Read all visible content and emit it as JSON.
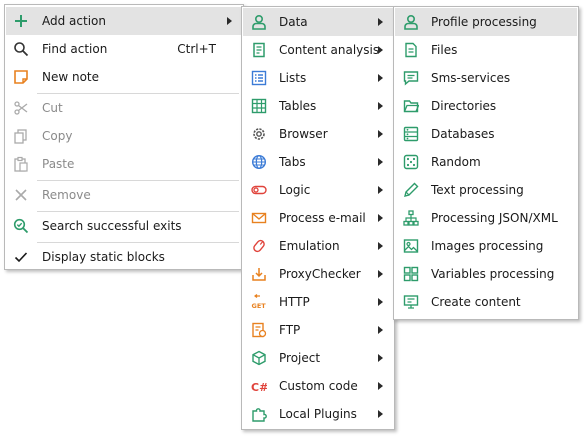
{
  "context_menu": {
    "items": [
      {
        "label": "Add action",
        "shortcut": ""
      },
      {
        "label": "Find action",
        "shortcut": "Ctrl+T"
      },
      {
        "label": "New note",
        "shortcut": ""
      },
      {
        "label": "Cut",
        "shortcut": ""
      },
      {
        "label": "Copy",
        "shortcut": ""
      },
      {
        "label": "Paste",
        "shortcut": ""
      },
      {
        "label": "Remove",
        "shortcut": ""
      },
      {
        "label": "Search successful exits",
        "shortcut": ""
      },
      {
        "label": "Display static blocks",
        "shortcut": ""
      }
    ]
  },
  "actions_menu": {
    "items": [
      {
        "label": "Data"
      },
      {
        "label": "Content analysis"
      },
      {
        "label": "Lists"
      },
      {
        "label": "Tables"
      },
      {
        "label": "Browser"
      },
      {
        "label": "Tabs"
      },
      {
        "label": "Logic"
      },
      {
        "label": "Process e-mail"
      },
      {
        "label": "Emulation"
      },
      {
        "label": "ProxyChecker"
      },
      {
        "label": "HTTP",
        "icon_text": "GET"
      },
      {
        "label": "FTP"
      },
      {
        "label": "Project"
      },
      {
        "label": "Custom code",
        "icon_text": "C#"
      },
      {
        "label": "Local Plugins"
      }
    ]
  },
  "data_menu": {
    "items": [
      {
        "label": "Profile processing"
      },
      {
        "label": "Files"
      },
      {
        "label": "Sms-services"
      },
      {
        "label": "Directories"
      },
      {
        "label": "Databases"
      },
      {
        "label": "Random"
      },
      {
        "label": "Text processing"
      },
      {
        "label": "Processing JSON/XML"
      },
      {
        "label": "Images processing"
      },
      {
        "label": "Variables processing"
      },
      {
        "label": "Create content"
      }
    ]
  },
  "colors": {
    "green": "#2e9c6b",
    "orange": "#e8811f",
    "red": "#e0433b",
    "blue": "#3b7bd6",
    "disabled": "#8a8a8a",
    "highlight": "#e3e3e3"
  }
}
